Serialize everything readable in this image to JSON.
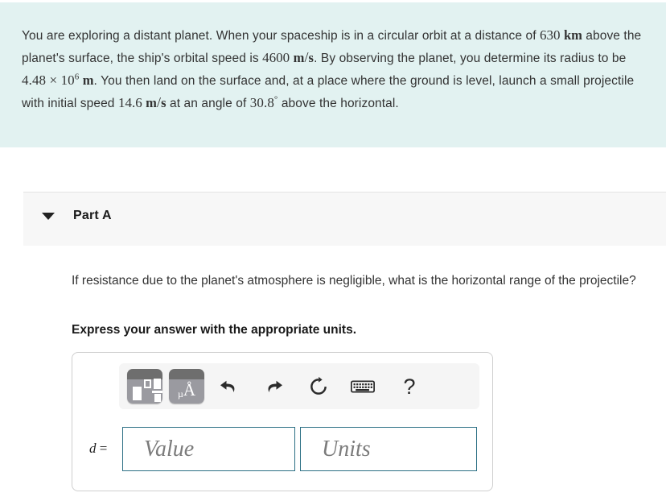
{
  "problem": {
    "seg1": "You are exploring a distant planet. When your spaceship is in a circular orbit at a distance of ",
    "dist_value": "630",
    "dist_unit": "km",
    "seg2": " above the planet's surface, the ship's orbital speed is ",
    "speed_value": "4600",
    "speed_unit_num": "m",
    "speed_unit_slash": "/",
    "speed_unit_den": "s",
    "seg3": ". By observing the planet, you determine its radius to be ",
    "radius_mantissa": "4.48",
    "radius_times": "×",
    "radius_base": "10",
    "radius_exp": "6",
    "radius_unit": "m",
    "seg4": ". You then land on the surface and, at a place where the ground is level, launch a small projectile with initial speed ",
    "launch_speed": "14.6",
    "launch_unit_num": "m",
    "launch_unit_slash": "/",
    "launch_unit_den": "s",
    "seg5": " at an angle of ",
    "angle_value": "30.8",
    "angle_deg": "°",
    "seg6": " above the horizontal."
  },
  "part": {
    "title": "Part A",
    "caret_icon": "triangle-down-icon"
  },
  "question": {
    "prompt": "If resistance due to the planet's atmosphere is negligible, what is the horizontal range of the projectile?",
    "instruction": "Express your answer with the appropriate units."
  },
  "answer_widget": {
    "toolbar": {
      "template_button": {
        "name": "math-template-palette-button",
        "label": ""
      },
      "units_button": {
        "name": "units-palette-button",
        "mu": "µ",
        "angstrom": "Å"
      },
      "undo_icon": "undo-icon",
      "redo_icon": "redo-icon",
      "reset_icon": "reset-icon",
      "keyboard_icon": "keyboard-icon",
      "help_icon": "help-icon",
      "help_label": "?"
    },
    "variable_label": "d",
    "equals_sign": "=",
    "value_placeholder": "Value",
    "units_placeholder": "Units",
    "value_current": "",
    "units_current": ""
  },
  "colors": {
    "banner_background": "#e2f2f1",
    "part_header_background": "#f7f7f7",
    "input_border": "#2c6f84",
    "toolbar_background": "#f5f5f5",
    "answer_box_border": "#cfcfcf",
    "text": "#333333"
  }
}
